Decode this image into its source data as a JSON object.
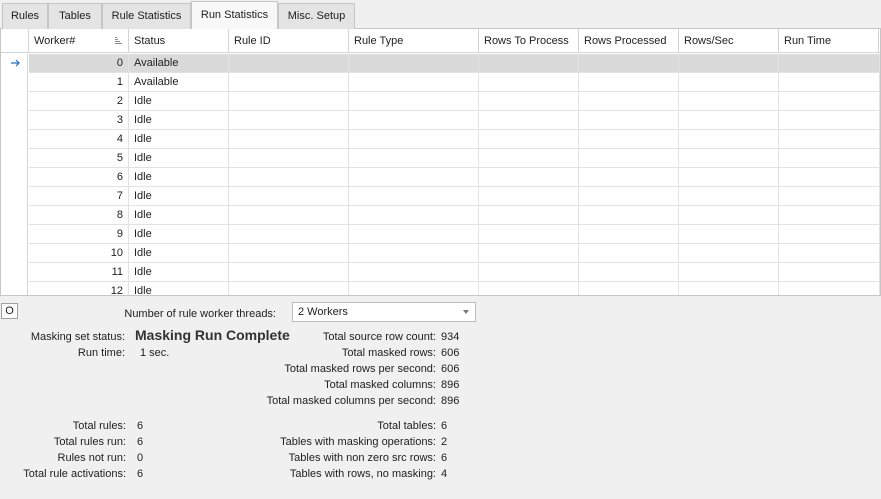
{
  "tabs": [
    {
      "label": "Rules",
      "active": false
    },
    {
      "label": "Tables",
      "active": false
    },
    {
      "label": "Rule Statistics",
      "active": false
    },
    {
      "label": "Run Statistics",
      "active": true
    },
    {
      "label": "Misc. Setup",
      "active": false
    }
  ],
  "grid": {
    "columns": [
      "Worker#",
      "Status",
      "Rule ID",
      "Rule Type",
      "Rows To Process",
      "Rows Processed",
      "Rows/Sec",
      "Run Time"
    ],
    "rows": [
      {
        "worker": "0",
        "status": "Available"
      },
      {
        "worker": "1",
        "status": "Available"
      },
      {
        "worker": "2",
        "status": "Idle"
      },
      {
        "worker": "3",
        "status": "Idle"
      },
      {
        "worker": "4",
        "status": "Idle"
      },
      {
        "worker": "5",
        "status": "Idle"
      },
      {
        "worker": "6",
        "status": "Idle"
      },
      {
        "worker": "7",
        "status": "Idle"
      },
      {
        "worker": "8",
        "status": "Idle"
      },
      {
        "worker": "9",
        "status": "Idle"
      },
      {
        "worker": "10",
        "status": "Idle"
      },
      {
        "worker": "11",
        "status": "Idle"
      },
      {
        "worker": "12",
        "status": "Idle"
      }
    ]
  },
  "panel": {
    "o_button": "O",
    "threads_label": "Number of rule worker threads:",
    "threads_value": "2 Workers",
    "masking_status_label": "Masking set status:",
    "masking_status_value": "Masking Run Complete",
    "run_time_label": "Run time:",
    "run_time_value": "1 sec.",
    "stats": [
      {
        "label": "Total source row count:",
        "value": "934"
      },
      {
        "label": "Total masked rows:",
        "value": "606"
      },
      {
        "label": "Total masked rows per second:",
        "value": "606"
      },
      {
        "label": "Total masked columns:",
        "value": "896"
      },
      {
        "label": "Total masked columns per second:",
        "value": "896"
      }
    ],
    "rule_stats": [
      {
        "label": "Total rules:",
        "value": "6"
      },
      {
        "label": "Total rules run:",
        "value": "6"
      },
      {
        "label": "Rules not run:",
        "value": "0"
      },
      {
        "label": "Total rule activations:",
        "value": "6"
      }
    ],
    "table_stats": [
      {
        "label": "Total tables:",
        "value": "6"
      },
      {
        "label": "Tables with masking operations:",
        "value": "2"
      },
      {
        "label": "Tables with non zero src rows:",
        "value": "6"
      },
      {
        "label": "Tables with rows, no masking:",
        "value": "4"
      }
    ]
  },
  "colors": {
    "selected_row": "#dadada",
    "arrow": "#1e6fd9"
  }
}
